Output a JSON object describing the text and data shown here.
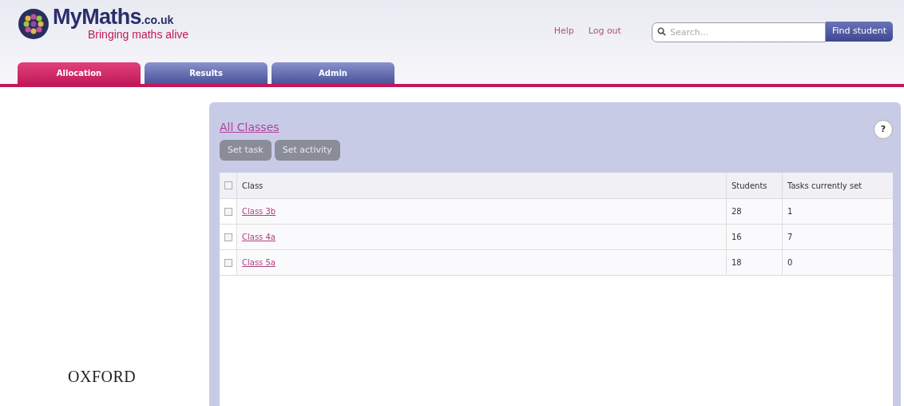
{
  "logo": {
    "name": "MyMaths",
    "domain": ".co.uk",
    "tagline": "Bringing maths alive"
  },
  "header_links": [
    "Help",
    "Log out"
  ],
  "search": {
    "placeholder": "Search...",
    "button": "Find student"
  },
  "tabs": [
    {
      "label": "Allocation",
      "selected": true
    },
    {
      "label": "Results",
      "selected": false
    },
    {
      "label": "Admin",
      "selected": false
    }
  ],
  "breadcrumb": "All Classes",
  "help_button": "?",
  "actions": [
    "Set task",
    "Set activity"
  ],
  "table": {
    "select_all_checked": false,
    "columns": [
      "Class",
      "Students",
      "Tasks currently set"
    ],
    "rows": [
      {
        "checked": false,
        "class": "Class 3b",
        "students": "28",
        "tasks": "1"
      },
      {
        "checked": false,
        "class": "Class 4a",
        "students": "16",
        "tasks": "7"
      },
      {
        "checked": false,
        "class": "Class 5a",
        "students": "18",
        "tasks": "0"
      }
    ]
  },
  "footer_brand": "OXFORD"
}
